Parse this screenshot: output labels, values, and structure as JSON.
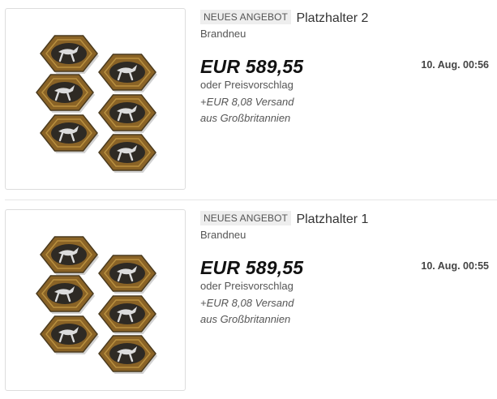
{
  "listings": [
    {
      "badge": "NEUES ANGEBOT",
      "title": "Platzhalter 2",
      "condition": "Brandneu",
      "price": "EUR 589,55",
      "offer": "oder Preisvorschlag",
      "shipping": "+EUR 8,08 Versand",
      "origin": "aus Großbritannien",
      "date": "10. Aug. 00:56"
    },
    {
      "badge": "NEUES ANGEBOT",
      "title": "Platzhalter 1",
      "condition": "Brandneu",
      "price": "EUR 589,55",
      "offer": "oder Preisvorschlag",
      "shipping": "+EUR 8,08 Versand",
      "origin": "aus Großbritannien",
      "date": "10. Aug. 00:55"
    }
  ],
  "colors": {
    "token_bronze": "#8a6326",
    "token_dark": "#4a3a1e",
    "token_inner": "#2e2a24",
    "token_silver": "#dcdcdc"
  }
}
